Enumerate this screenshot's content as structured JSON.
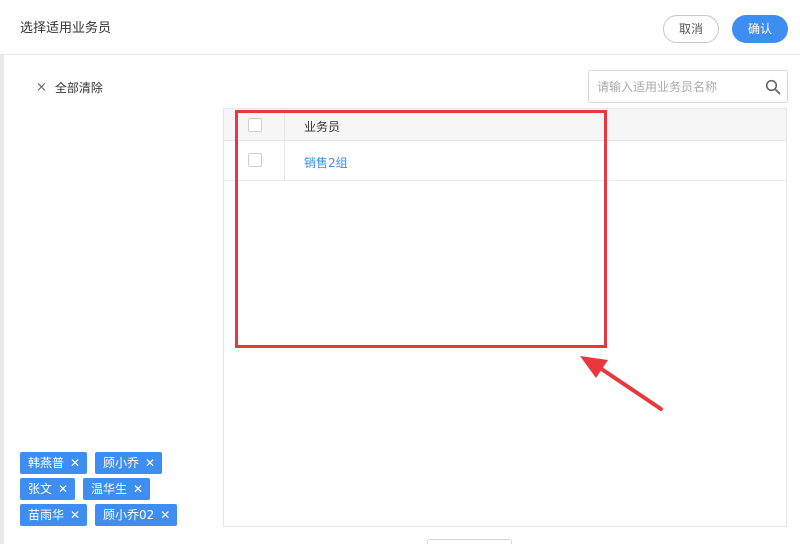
{
  "dialog": {
    "title": "选择适用业务员",
    "cancel_label": "取消",
    "confirm_label": "确认"
  },
  "selection": {
    "clear_icon": "×",
    "clear_label": "全部清除",
    "tags": [
      {
        "label": "韩燕普"
      },
      {
        "label": "顾小乔"
      },
      {
        "label": "张文"
      },
      {
        "label": "温华生"
      },
      {
        "label": "苗雨华"
      },
      {
        "label": "顾小乔02"
      }
    ],
    "tag_close_glyph": "✕"
  },
  "search": {
    "placeholder": "请输入适用业务员名称",
    "value": "",
    "icon": "search-icon"
  },
  "table": {
    "column_header": "业务员",
    "rows": [
      {
        "name": "销售2组",
        "checked": false
      }
    ]
  },
  "colors": {
    "accent": "#3d8ef0",
    "annotation": "#e8383d"
  }
}
